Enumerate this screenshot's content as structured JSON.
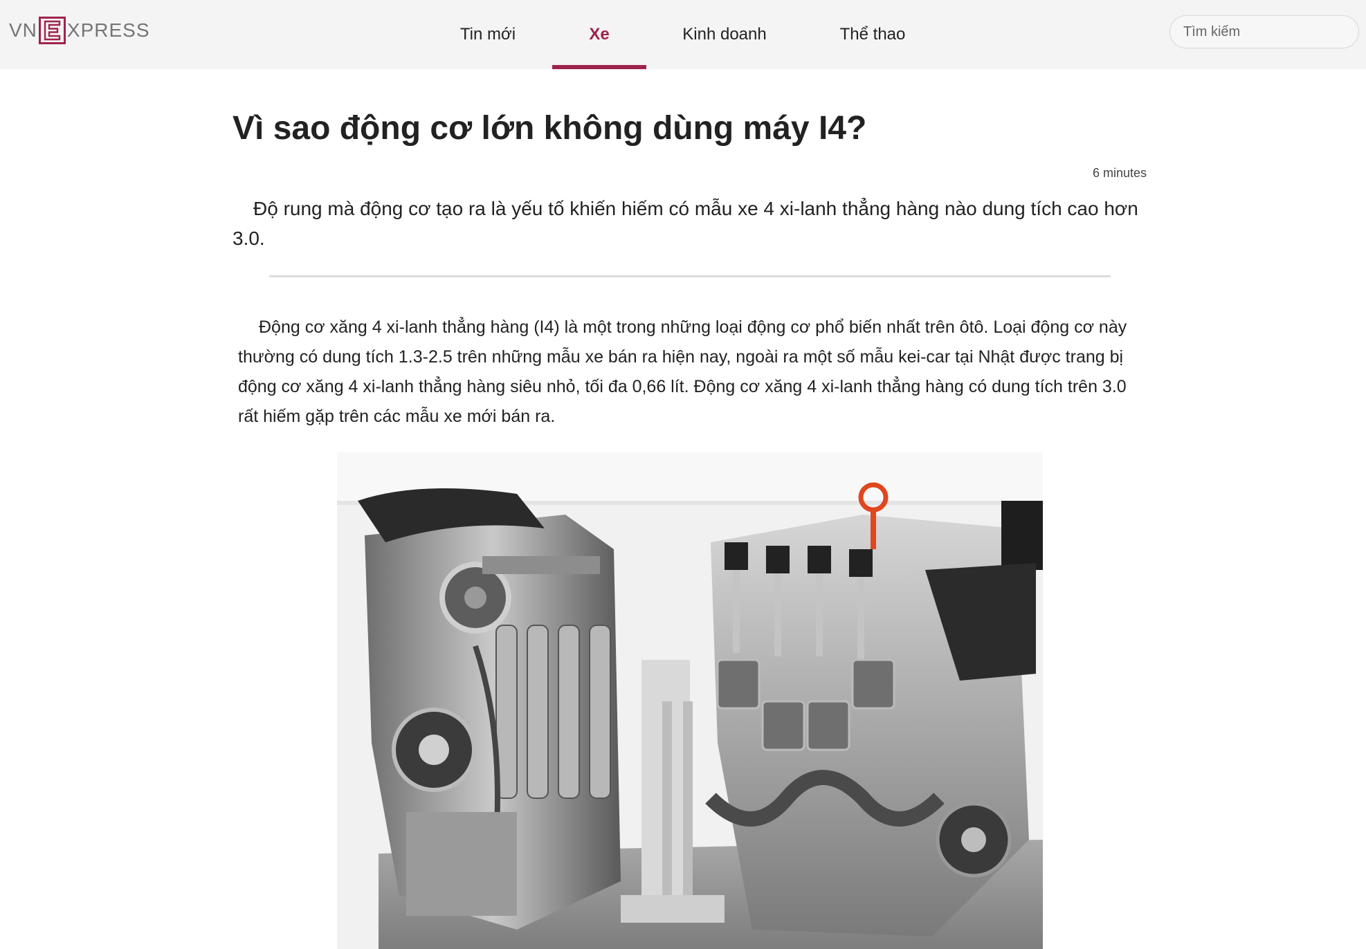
{
  "header": {
    "logo": {
      "left": "VN",
      "middle": "E",
      "right": "XPRESS"
    },
    "nav": [
      {
        "label": "Tin mới",
        "active": false
      },
      {
        "label": "Xe",
        "active": true
      },
      {
        "label": "Kinh doanh",
        "active": false
      },
      {
        "label": "Thể thao",
        "active": false
      }
    ],
    "search": {
      "placeholder": "Tìm kiếm",
      "value": ""
    }
  },
  "article": {
    "title": "Vì sao động cơ lớn không dùng máy I4?",
    "read_time": "6 minutes",
    "lead": "Độ rung mà động cơ tạo ra là yếu tố khiến hiếm có mẫu xe 4 xi-lanh thẳng hàng nào dung tích cao hơn 3.0.",
    "body": "Động cơ xăng 4 xi-lanh thẳng hàng (I4) là một trong những loại động cơ phổ biến nhất trên ôtô. Loại động cơ này thường có dung tích 1.3-2.5 trên những mẫu xe bán ra hiện nay, ngoài ra một số mẫu kei-car tại Nhật được trang bị động cơ xăng 4 xi-lanh thẳng hàng siêu nhỏ, tối đa 0,66 lít. Động cơ xăng 4 xi-lanh thẳng hàng có dung tích trên 3.0 rất hiếm gặp trên các mẫu xe mới bán ra."
  },
  "colors": {
    "brand": "#9f224e",
    "header_bg": "#f4f4f4",
    "text": "#222222"
  }
}
